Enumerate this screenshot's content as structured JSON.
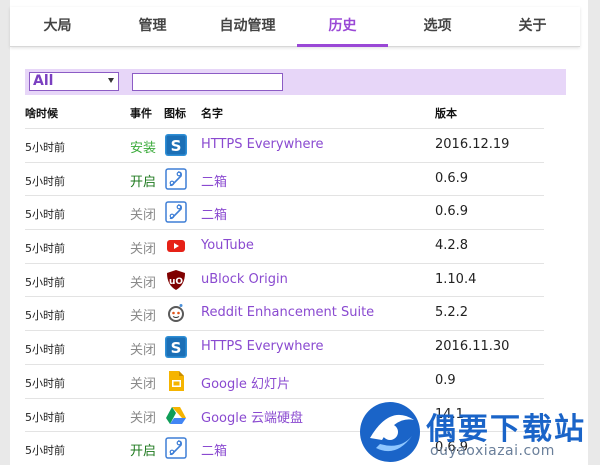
{
  "tabs": [
    {
      "label": "大局"
    },
    {
      "label": "管理"
    },
    {
      "label": "自动管理"
    },
    {
      "label": "历史"
    },
    {
      "label": "选项"
    },
    {
      "label": "关于"
    }
  ],
  "active_tab": "历史",
  "filter": {
    "select_value": "All",
    "search_placeholder": ""
  },
  "table": {
    "headers": {
      "time": "啥时候",
      "event": "事件",
      "icon": "图标",
      "name": "名字",
      "version": "版本"
    },
    "rows": [
      {
        "time": "5小时前",
        "event": "安装",
        "event_type": "install",
        "icon": "https-everywhere-icon",
        "name": "HTTPS Everywhere",
        "version": "2016.12.19"
      },
      {
        "time": "5小时前",
        "event": "开启",
        "event_type": "enable",
        "icon": "erxiang-icon",
        "name": "二箱",
        "version": "0.6.9"
      },
      {
        "time": "5小时前",
        "event": "关闭",
        "event_type": "disable",
        "icon": "erxiang-icon",
        "name": "二箱",
        "version": "0.6.9"
      },
      {
        "time": "5小时前",
        "event": "关闭",
        "event_type": "disable",
        "icon": "youtube-icon",
        "name": "YouTube",
        "version": "4.2.8"
      },
      {
        "time": "5小时前",
        "event": "关闭",
        "event_type": "disable",
        "icon": "ublock-origin-icon",
        "name": "uBlock Origin",
        "version": "1.10.4"
      },
      {
        "time": "5小时前",
        "event": "关闭",
        "event_type": "disable",
        "icon": "reddit-icon",
        "name": "Reddit Enhancement Suite",
        "version": "5.2.2"
      },
      {
        "time": "5小时前",
        "event": "关闭",
        "event_type": "disable",
        "icon": "https-everywhere-icon",
        "name": "HTTPS Everywhere",
        "version": "2016.11.30"
      },
      {
        "time": "5小时前",
        "event": "关闭",
        "event_type": "disable",
        "icon": "google-slides-icon",
        "name": "Google 幻灯片",
        "version": "0.9"
      },
      {
        "time": "5小时前",
        "event": "关闭",
        "event_type": "disable",
        "icon": "google-drive-icon",
        "name": "Google 云端硬盘",
        "version": "14.1"
      },
      {
        "time": "5小时前",
        "event": "开启",
        "event_type": "enable",
        "icon": "erxiang-icon",
        "name": "二箱",
        "version": "0.6.9"
      }
    ]
  },
  "watermark": {
    "title": "偶要下载站",
    "subtitle": "ouyaoxiazai.com"
  },
  "colors": {
    "accent": "#9a48d6",
    "filter_bg": "#e7d6f8",
    "install": "#3cab3c",
    "enable": "#1f7a1f",
    "disable": "#8a8a8a"
  }
}
